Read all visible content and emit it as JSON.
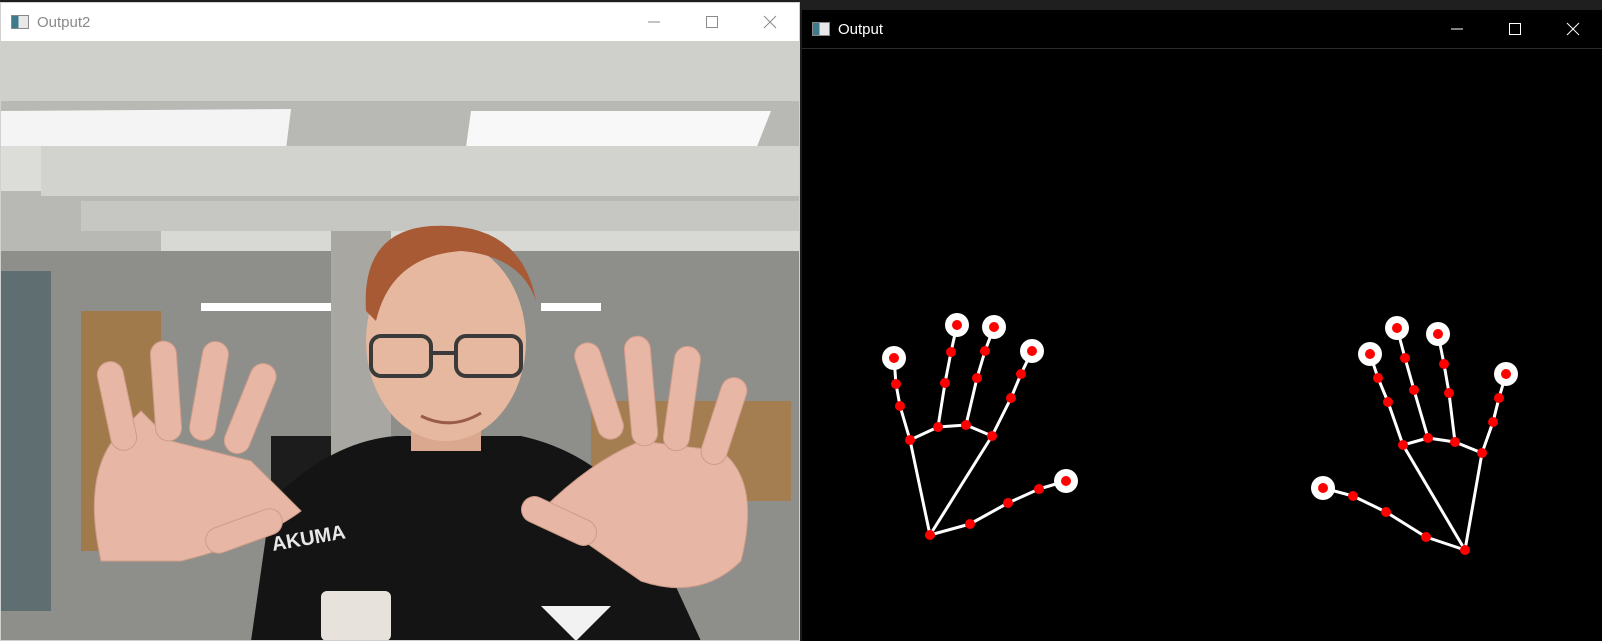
{
  "windows": [
    {
      "id": "output2",
      "title": "Output2",
      "icon": "app-window-icon",
      "controls": [
        "minimize-icon",
        "maximize-icon",
        "close-icon"
      ],
      "content": "webcam-frame"
    },
    {
      "id": "output",
      "title": "Output",
      "icon": "app-window-icon",
      "controls": [
        "minimize-icon",
        "maximize-icon",
        "close-icon"
      ],
      "content": "hand-landmark-skeleton"
    }
  ],
  "photo_text": {
    "jacket_brand": "AKUMA"
  },
  "colors": {
    "landmark": "#ff0000",
    "bone": "#ffffff",
    "background": "#000000"
  }
}
